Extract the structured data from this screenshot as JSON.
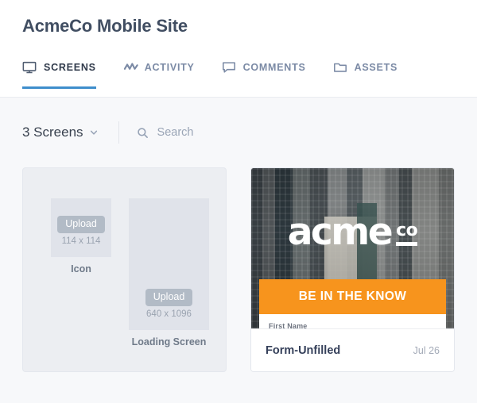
{
  "header": {
    "title": "AcmeCo Mobile Site",
    "tabs": [
      {
        "label": "SCREENS",
        "icon": "monitor-icon",
        "active": true
      },
      {
        "label": "ACTIVITY",
        "icon": "pulse-icon",
        "active": false
      },
      {
        "label": "COMMENTS",
        "icon": "comment-icon",
        "active": false
      },
      {
        "label": "ASSETS",
        "icon": "folder-icon",
        "active": false
      }
    ],
    "active_tab_color": "#3e8ecc"
  },
  "toolbar": {
    "screens_count_label": "3 Screens",
    "chevron_icon": "chevron-down-icon",
    "search_icon": "search-icon",
    "search_value": "",
    "search_placeholder": "Search"
  },
  "cards": {
    "placeholder": {
      "icon_slot": {
        "upload_label": "Upload",
        "dimensions": "114 x 114",
        "caption": "Icon"
      },
      "loading_slot": {
        "upload_label": "Upload",
        "dimensions": "640 x 1096",
        "caption": "Loading Screen"
      }
    },
    "screen": {
      "logo_main": "acme",
      "logo_sub": "co",
      "banner_text": "BE IN THE KNOW",
      "banner_color": "#f7941d",
      "form_field_label": "First Name",
      "name": "Form-Unfilled",
      "date": "Jul 26"
    }
  }
}
